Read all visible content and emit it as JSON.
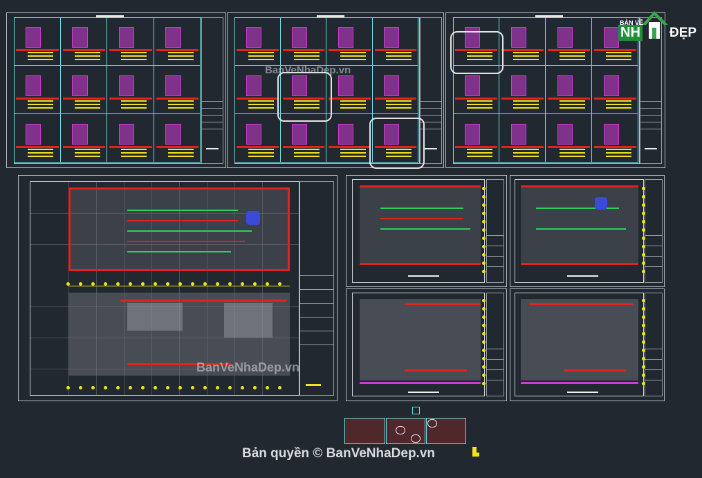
{
  "watermarks": {
    "top": "BanVeNhaDep.vn",
    "middle": "BanVeNhaDep.vn"
  },
  "copyright": "Bản quyền © BanVeNhaDep.vn",
  "logo": {
    "line1": "BẢN VẼ",
    "line2a": "NH",
    "line2b": "ĐẸP"
  },
  "colors": {
    "background": "#212830",
    "cyan_frame": "#6ee0e6",
    "red": "#e0241b",
    "yellow": "#f3e21c",
    "magenta": "#d03ad6",
    "logo_green": "#1f8f3a"
  }
}
